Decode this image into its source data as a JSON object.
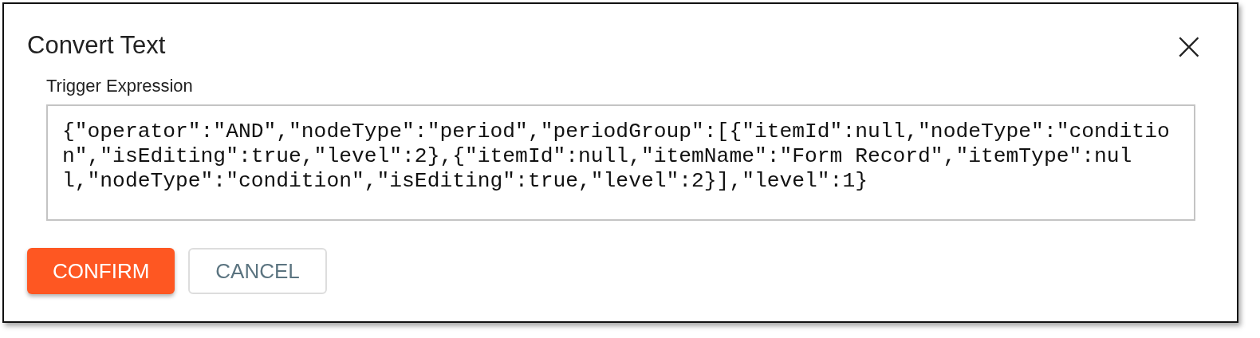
{
  "dialog": {
    "title": "Convert Text",
    "close": "×"
  },
  "field": {
    "label": "Trigger Expression",
    "value": "{\"operator\":\"AND\",\"nodeType\":\"period\",\"periodGroup\":[{\"itemId\":null,\"nodeType\":\"condition\",\"isEditing\":true,\"level\":2},{\"itemId\":null,\"itemName\":\"Form Record\",\"itemType\":null,\"nodeType\":\"condition\",\"isEditing\":true,\"level\":2}],\"level\":1}"
  },
  "buttons": [
    {
      "label": "CONFIRM",
      "kind": "primary"
    },
    {
      "label": "CANCEL",
      "kind": "secondary"
    }
  ]
}
